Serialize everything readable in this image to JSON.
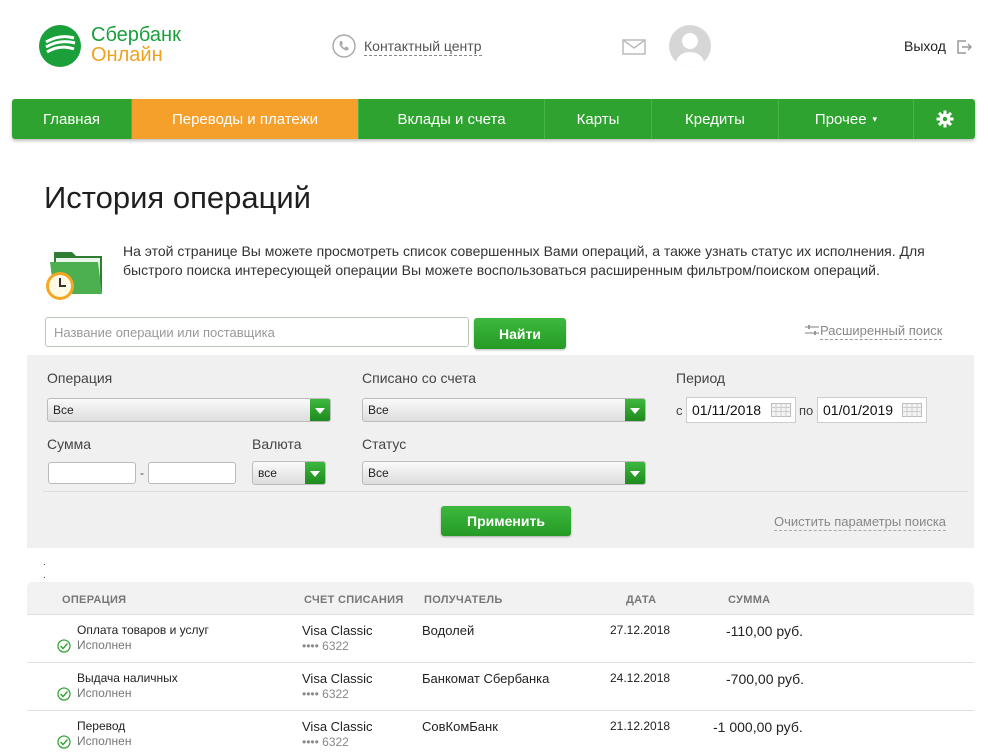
{
  "brand": {
    "name_line1": "Сбербанк",
    "name_line2": "Онлайн",
    "green": "#1a9f3a",
    "orange": "#f0a21e"
  },
  "header": {
    "contact_center": "Контактный центр",
    "logout": "Выход"
  },
  "nav": {
    "items": [
      {
        "label": "Главная",
        "active": false
      },
      {
        "label": "Переводы и платежи",
        "active": true
      },
      {
        "label": "Вклады и счета",
        "active": false
      },
      {
        "label": "Карты",
        "active": false
      },
      {
        "label": "Кредиты",
        "active": false
      },
      {
        "label": "Прочее",
        "active": false
      }
    ],
    "more_arrow": "▾",
    "settings_icon": "gear-icon"
  },
  "page": {
    "title": "История операций",
    "intro": "На этой странице Вы можете просмотреть список совершенных Вами операций, а также узнать статус их исполнения. Для быстрого поиска интересующей операции Вы можете воспользоваться расширенным фильтром/поиском операций."
  },
  "search": {
    "placeholder": "Название операции или поставщика",
    "value": "",
    "button": "Найти",
    "advanced": "Расширенный поиск"
  },
  "filters": {
    "operation_label": "Операция",
    "operation_value": "Все",
    "account_label": "Списано со счета",
    "account_value": "Все",
    "period_label": "Период",
    "period_from_prefix": "с",
    "period_from": "01/11/2018",
    "period_to_prefix": "по",
    "period_to": "01/01/2019",
    "amount_label": "Сумма",
    "amount_from": "",
    "amount_to": "",
    "amount_dash": "-",
    "currency_label": "Валюта",
    "currency_value": "все",
    "status_label": "Статус",
    "status_value": "Все",
    "apply": "Применить",
    "clear": "Очистить параметры поиска"
  },
  "separator_dots": ".",
  "table": {
    "headers": {
      "operation": "ОПЕРАЦИЯ",
      "account": "СЧЕТ СПИСАНИЯ",
      "recipient": "ПОЛУЧАТЕЛЬ",
      "date": "ДАТА",
      "amount": "СУММА"
    },
    "rows": [
      {
        "name": "Оплата товаров и услуг",
        "status": "Исполнен",
        "account": "Visa Classic",
        "account_num": "•••• 6322",
        "recipient": "Водолей",
        "date": "27.12.2018",
        "amount": "-110,00 руб."
      },
      {
        "name": "Выдача наличных",
        "status": "Исполнен",
        "account": "Visa Classic",
        "account_num": "•••• 6322",
        "recipient": "Банкомат Сбербанка",
        "date": "24.12.2018",
        "amount": "-700,00 руб."
      },
      {
        "name": "Перевод",
        "status": "Исполнен",
        "account": "Visa Classic",
        "account_num": "•••• 6322",
        "recipient": "СовКомБанк",
        "date": "21.12.2018",
        "amount": "-1 000,00 руб."
      }
    ]
  }
}
